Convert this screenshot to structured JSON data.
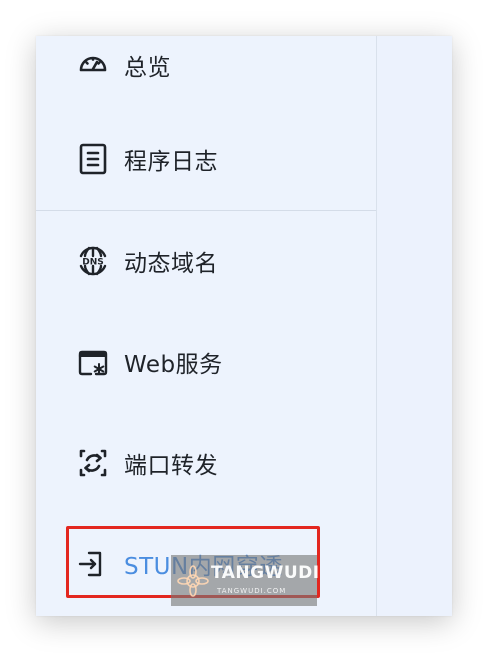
{
  "nav": {
    "items": [
      {
        "label": "总览",
        "icon": "dashboard-icon"
      },
      {
        "label": "程序日志",
        "icon": "log-icon"
      },
      {
        "label": "动态域名",
        "icon": "dns-icon"
      },
      {
        "label": "Web服务",
        "icon": "web-service-icon"
      },
      {
        "label": "端口转发",
        "icon": "port-forward-icon"
      },
      {
        "label": "STUN内网穿透",
        "icon": "stun-icon",
        "active": true
      }
    ]
  },
  "watermark": {
    "text": "TANGWUDI",
    "sub": "TANGWUDI.COM"
  },
  "colors": {
    "background": "#edf3fd",
    "active_label": "#4a8de0",
    "highlight_border": "#e3261f",
    "label": "#1f2329"
  }
}
